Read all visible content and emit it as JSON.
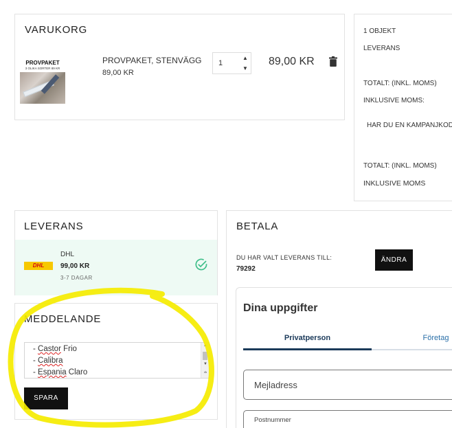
{
  "cart": {
    "title": "VARUKORG",
    "item": {
      "thumb_label": "PROVPAKET",
      "thumb_sublabel": "3 OLIKA SORTER 89 KR",
      "name": "PROVPAKET, STENVÄGG",
      "unit_price": "89,00 KR",
      "quantity": "1",
      "total": "89,00 KR"
    }
  },
  "summary": {
    "count": "1 OBJEKT",
    "shipping": "LEVERANS",
    "total_label": "TOTALT: (INKL. MOMS)",
    "vat_label": "INKLUSIVE MOMS:",
    "campaign": "HAR DU EN KAMPANJKOD?",
    "total_label_2": "TOTALT: (INKL. MOMS)",
    "vat_label_2": "INKLUSIVE MOMS"
  },
  "shipping": {
    "title": "LEVERANS",
    "option": {
      "logo_text": "DHL",
      "carrier": "DHL",
      "price": "99,00 KR",
      "days": "3-7 DAGAR"
    }
  },
  "message": {
    "title": "MEDDELANDE",
    "lines": [
      {
        "prefix": "- ",
        "word": "Castor",
        "rest": " Frio"
      },
      {
        "prefix": "- ",
        "word": "Calibra",
        "rest": ""
      },
      {
        "prefix": "- ",
        "word": "Espania",
        "rest": " Claro"
      }
    ],
    "save_label": "SPARA"
  },
  "pay": {
    "title": "BETALA",
    "chosen_label": "DU HAR VALT LEVERANS TILL:",
    "zip": "79292",
    "change_label": "ÄNDRA",
    "form": {
      "title": "Dina uppgifter",
      "tab_private": "Privatperson",
      "tab_company": "Företag",
      "email_placeholder": "Mejladress",
      "zip_label": "Postnummer"
    }
  },
  "colors": {
    "accent_dark": "#111111",
    "shipping_bg": "#eefaf4",
    "check_green": "#3fbf8a",
    "tab_active": "#1b3a5a",
    "highlighter": "#f5ec00"
  }
}
